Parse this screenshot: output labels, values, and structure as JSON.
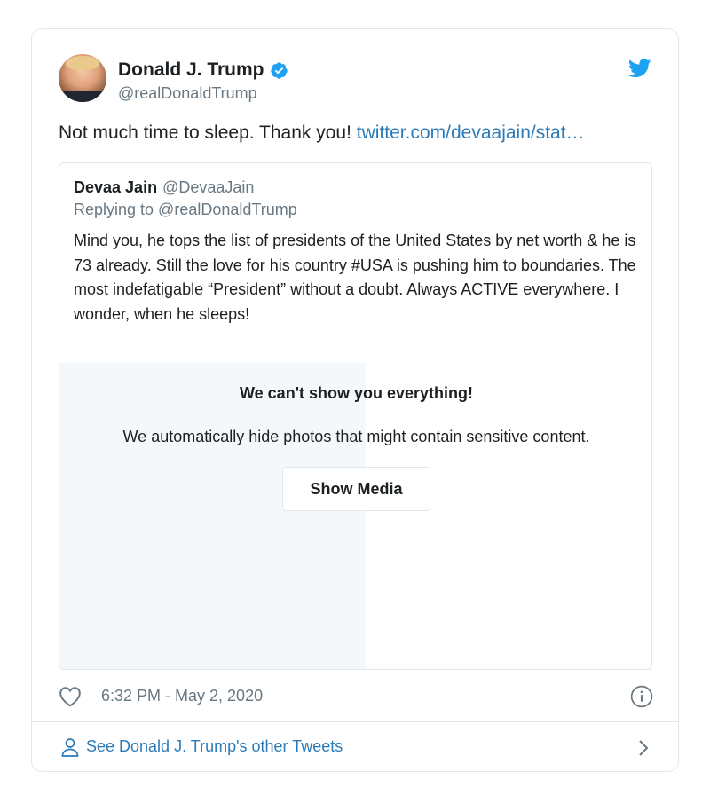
{
  "author": {
    "name": "Donald J. Trump",
    "handle": "@realDonaldTrump"
  },
  "tweet": {
    "text": "Not much time to sleep. Thank you! ",
    "link": "twitter.com/devaajain/stat…"
  },
  "quote": {
    "name": "Devaa Jain",
    "handle": "@DevaaJain",
    "replying": "Replying to @realDonaldTrump",
    "text": "Mind you, he tops the list of presidents of the United States by net worth & he is 73 already.  Still the love for his country #USA is pushing him to boundaries.  The most indefatigable “President” without a doubt. Always ACTIVE everywhere. I wonder, when he sleeps!",
    "sensitive_title": "We can't show you everything!",
    "sensitive_desc": "We automatically hide photos that might contain sensitive content.",
    "show_media": "Show Media"
  },
  "footer": {
    "timestamp": "6:32 PM - May 2, 2020",
    "more_tweets": "See Donald J. Trump's other Tweets"
  },
  "colors": {
    "link": "#2b7bb9",
    "verified": "#1da1f2",
    "muted": "#697882",
    "border": "#e1e8ed"
  }
}
